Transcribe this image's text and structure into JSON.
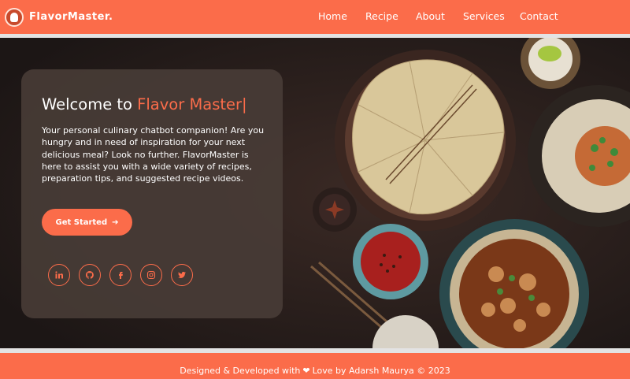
{
  "brand": {
    "name": "FlavorMaster."
  },
  "nav": {
    "home": "Home",
    "recipe": "Recipe",
    "about": "About",
    "services": "Services",
    "contact": "Contact"
  },
  "hero": {
    "title_prefix": "Welcome to ",
    "title_accent": "Flavor Master|",
    "description": "Your personal culinary chatbot companion! Are you hungry and in need of inspiration for your next delicious meal? Look no further. FlavorMaster is here to assist you with a wide variety of recipes, preparation tips, and suggested recipe videos.",
    "cta_label": "Get Started",
    "socials": [
      "linkedin-icon",
      "github-icon",
      "facebook-icon",
      "instagram-icon",
      "twitter-icon"
    ]
  },
  "footer": {
    "prefix": "Designed & Developed with",
    "suffix": "Love by Adarsh Maurya © 2023"
  },
  "colors": {
    "accent": "#fb6c4a",
    "card": "#483c36",
    "background": "#241c19"
  }
}
